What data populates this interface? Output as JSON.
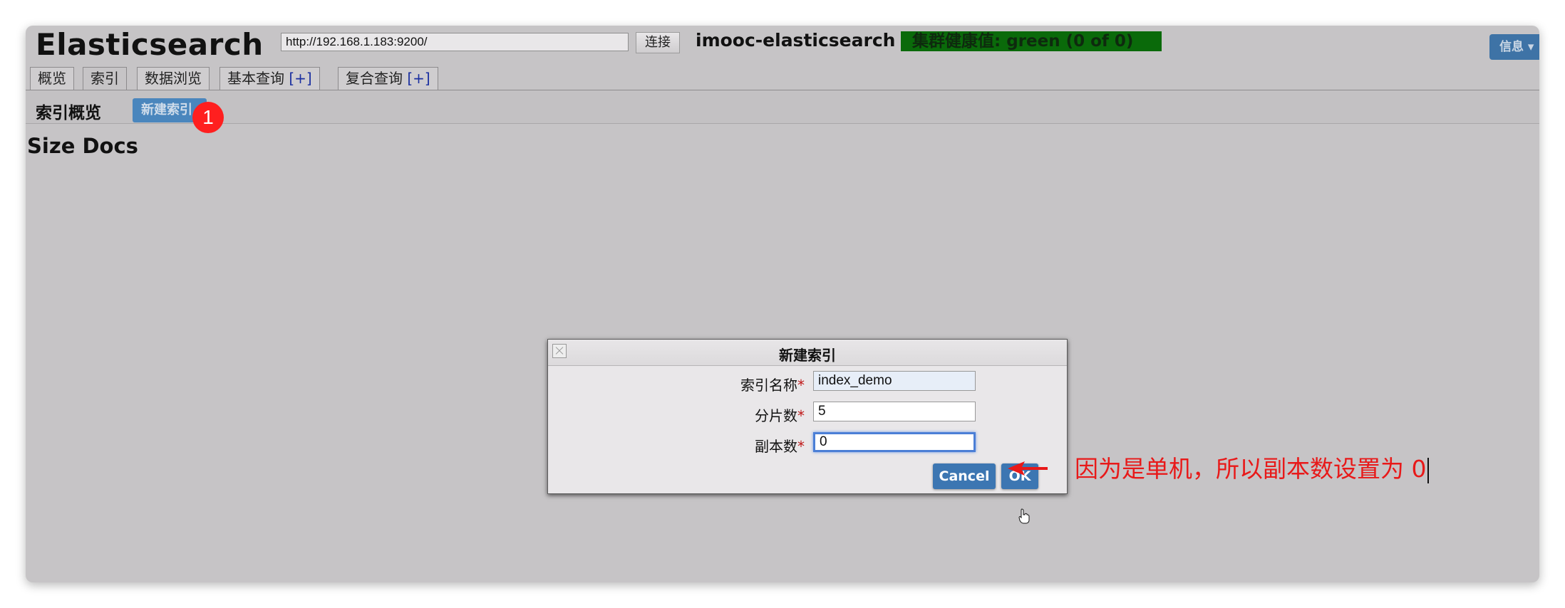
{
  "header": {
    "app_title": "Elasticsearch",
    "url_value": "http://192.168.1.183:9200/",
    "connect_label": "连接",
    "cluster_name": "imooc-elasticsearch",
    "health_status": "集群健康值: green (0 of 0)",
    "info_label": "信息 ▾"
  },
  "tabs": [
    {
      "label": "概览"
    },
    {
      "label": "索引"
    },
    {
      "label": "数据浏览"
    },
    {
      "label": "基本查询",
      "suffix": "[+]"
    },
    {
      "label": "复合查询",
      "suffix": "[+]"
    }
  ],
  "toolbar": {
    "title": "索引概览",
    "new_index_label": "新建索引",
    "step_badge": "1"
  },
  "table": {
    "col1": "Size",
    "col2": "Docs"
  },
  "dialog": {
    "title": "新建索引",
    "fields": [
      {
        "label": "索引名称",
        "required": "*",
        "value": "index_demo"
      },
      {
        "label": "分片数",
        "required": "*",
        "value": "5"
      },
      {
        "label": "副本数",
        "required": "*",
        "value": "0"
      }
    ],
    "cancel_label": "Cancel",
    "ok_label": "OK"
  },
  "annotation": {
    "text": "因为是单机，所以副本数设置为 0",
    "color": "#e81919"
  },
  "colors": {
    "health_bg": "#0a6a0a",
    "button_blue": "#3c76b2",
    "badge_red": "#ff1f1f"
  }
}
